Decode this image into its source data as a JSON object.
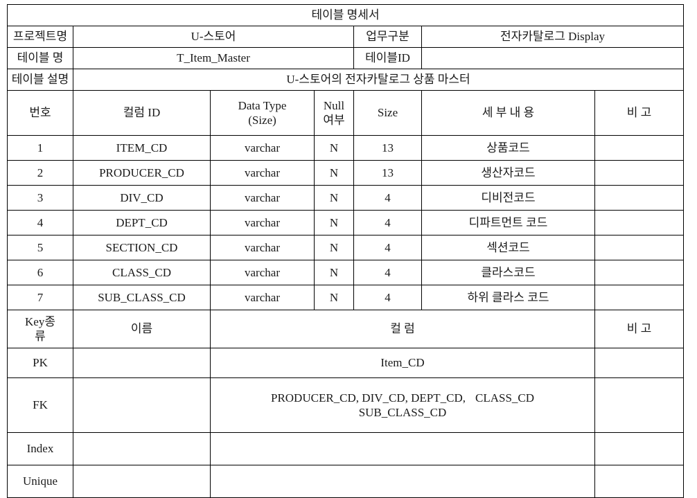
{
  "document": {
    "title": "테이블 명세서",
    "header_bg": "#c0c0c0",
    "border_color": "#000000"
  },
  "info": {
    "project_label": "프로젝트명",
    "project_value": "U-스토어",
    "task_label": "업무구분",
    "task_value": "전자카탈로그 Display",
    "table_name_label": "테이블 명",
    "table_name_value": "T_Item_Master",
    "table_id_label": "테이블ID",
    "table_id_value": "",
    "table_desc_label": "테이블 설명",
    "table_desc_value": "U-스토어의 전자카탈로그 상품 마스터"
  },
  "columns_table": {
    "headers": {
      "no": "번호",
      "column_id": "컬럼 ID",
      "data_type_line1": "Data Type",
      "data_type_line2": "(Size)",
      "null_line1": "Null",
      "null_line2": "여부",
      "size": "Size",
      "detail": "세 부 내 용",
      "remark": "비 고"
    },
    "rows": [
      {
        "no": "1",
        "column_id": "ITEM_CD",
        "data_type": "varchar",
        "null": "N",
        "size": "13",
        "detail": "상품코드",
        "remark": ""
      },
      {
        "no": "2",
        "column_id": "PRODUCER_CD",
        "data_type": "varchar",
        "null": "N",
        "size": "13",
        "detail": "생산자코드",
        "remark": ""
      },
      {
        "no": "3",
        "column_id": "DIV_CD",
        "data_type": "varchar",
        "null": "N",
        "size": "4",
        "detail": "디비전코드",
        "remark": ""
      },
      {
        "no": "4",
        "column_id": "DEPT_CD",
        "data_type": "varchar",
        "null": "N",
        "size": "4",
        "detail": "디파트먼트 코드",
        "remark": ""
      },
      {
        "no": "5",
        "column_id": "SECTION_CD",
        "data_type": "varchar",
        "null": "N",
        "size": "4",
        "detail": "섹션코드",
        "remark": ""
      },
      {
        "no": "6",
        "column_id": "CLASS_CD",
        "data_type": "varchar",
        "null": "N",
        "size": "4",
        "detail": "클라스코드",
        "remark": ""
      },
      {
        "no": "7",
        "column_id": "SUB_CLASS_CD",
        "data_type": "varchar",
        "null": "N",
        "size": "4",
        "detail": "하위 클라스 코드",
        "remark": ""
      }
    ]
  },
  "key_table": {
    "headers": {
      "key_type_line1": "Key종",
      "key_type_line2": "류",
      "name": "이름",
      "column": "컬 럼",
      "remark": "비 고"
    },
    "rows": [
      {
        "key_type": "PK",
        "name": "",
        "column_line1": "Item_CD",
        "column_line2": "",
        "remark": ""
      },
      {
        "key_type": "FK",
        "name": "",
        "column_line1": "PRODUCER_CD, DIV_CD, DEPT_CD,",
        "column_line1b": "CLASS_CD",
        "column_line2": "SUB_CLASS_CD",
        "remark": ""
      },
      {
        "key_type": "Index",
        "name": "",
        "column_line1": "",
        "column_line2": "",
        "remark": ""
      },
      {
        "key_type": "Unique",
        "name": "",
        "column_line1": "",
        "column_line2": "",
        "remark": ""
      }
    ]
  }
}
